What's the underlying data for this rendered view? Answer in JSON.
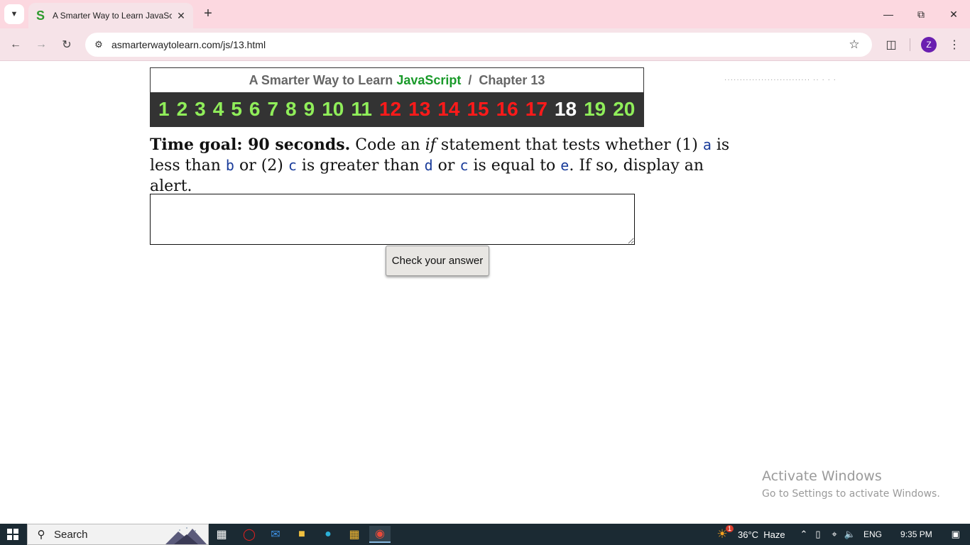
{
  "browser": {
    "tab_title": "A Smarter Way to Learn JavaScr",
    "favicon_letter": "S",
    "url": "asmarterwaytolearn.com/js/13.html",
    "avatar_letter": "Z"
  },
  "header": {
    "title_prefix": "A Smarter Way to Learn",
    "title_brand": "JavaScript",
    "separator": "/",
    "chapter": "Chapter 13"
  },
  "chapters": [
    {
      "label": "1",
      "state": "done"
    },
    {
      "label": "2",
      "state": "done"
    },
    {
      "label": "3",
      "state": "done"
    },
    {
      "label": "4",
      "state": "done"
    },
    {
      "label": "5",
      "state": "done"
    },
    {
      "label": "6",
      "state": "done"
    },
    {
      "label": "7",
      "state": "done"
    },
    {
      "label": "8",
      "state": "done"
    },
    {
      "label": "9",
      "state": "done"
    },
    {
      "label": "10",
      "state": "done"
    },
    {
      "label": "11",
      "state": "done"
    },
    {
      "label": "12",
      "state": "wrong"
    },
    {
      "label": "13",
      "state": "wrong"
    },
    {
      "label": "14",
      "state": "wrong"
    },
    {
      "label": "15",
      "state": "wrong"
    },
    {
      "label": "16",
      "state": "wrong"
    },
    {
      "label": "17",
      "state": "wrong"
    },
    {
      "label": "18",
      "state": "current"
    },
    {
      "label": "19",
      "state": "done"
    },
    {
      "label": "20",
      "state": "done"
    }
  ],
  "colors": {
    "done": "#90ee5a",
    "wrong": "#ff1a1a",
    "current": "#ffffff",
    "brand": "#1a9a2a"
  },
  "question": {
    "goal": "Time goal: 90 seconds.",
    "p1": " Code an ",
    "p1_em": "if",
    "p2": " statement that tests whether (1) ",
    "v_a": "a",
    "p3": " is less than ",
    "v_b": "b",
    "p4": " or (2) ",
    "v_c": "c",
    "p5": " is greater than ",
    "v_d": "d",
    "p6": " or ",
    "v_c2": "c",
    "p7": " is equal to ",
    "v_e": "e",
    "p8": ". If so, display an alert."
  },
  "answer": {
    "value": ""
  },
  "check_button": "Check your answer",
  "watermark": {
    "line1": "Activate Windows",
    "line2": "Go to Settings to activate Windows."
  },
  "taskbar": {
    "search_label": "Search",
    "weather": "36°C  Haze",
    "weather_badge": "1",
    "language": "ENG",
    "time": "9:35 PM"
  }
}
